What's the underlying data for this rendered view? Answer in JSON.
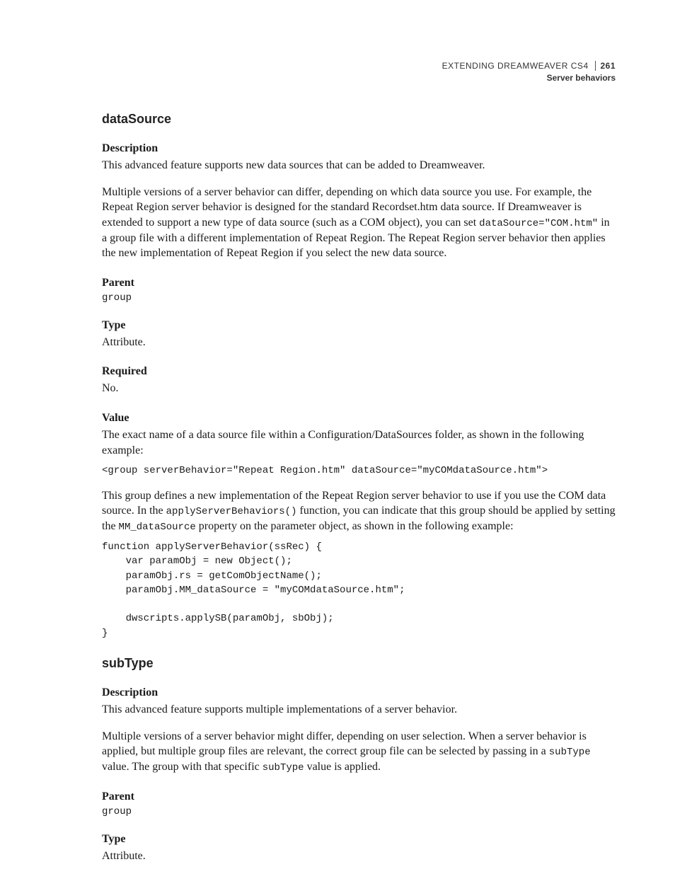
{
  "header": {
    "book": "EXTENDING DREAMWEAVER CS4",
    "page_number": "261",
    "chapter": "Server behaviors"
  },
  "section1": {
    "title": "dataSource",
    "description_label": "Description",
    "description_p1": "This advanced feature supports new data sources that can be added to Dreamweaver.",
    "description_p2_a": "Multiple versions of a server behavior can differ, depending on which data source you use. For example, the Repeat Region server behavior is designed for the standard Recordset.htm data source. If Dreamweaver is extended to support a new type of data source (such as a COM object), you can set ",
    "description_p2_code": "dataSource=\"COM.htm\"",
    "description_p2_b": " in a group file with a different implementation of Repeat Region. The Repeat Region server behavior then applies the new implementation of Repeat Region if you select the new data source.",
    "parent_label": "Parent",
    "parent_value": "group",
    "type_label": "Type",
    "type_value": "Attribute.",
    "required_label": "Required",
    "required_value": "No.",
    "value_label": "Value",
    "value_p1": "The exact name of a data source file within a Configuration/DataSources folder, as shown in the following example:",
    "value_code1": "<group serverBehavior=\"Repeat Region.htm\" dataSource=\"myCOMdataSource.htm\">",
    "value_p2_a": "This group defines a new implementation of the Repeat Region server behavior to use if you use the COM data source. In the ",
    "value_p2_code1": "applyServerBehaviors()",
    "value_p2_b": " function, you can indicate that this group should be applied by setting the ",
    "value_p2_code2": "MM_dataSource",
    "value_p2_c": " property on the parameter object, as shown in the following example:",
    "value_code2": "function applyServerBehavior(ssRec) {\n    var paramObj = new Object();\n    paramObj.rs = getComObjectName();\n    paramObj.MM_dataSource = \"myCOMdataSource.htm\";\n\n    dwscripts.applySB(paramObj, sbObj);\n}"
  },
  "section2": {
    "title": "subType",
    "description_label": "Description",
    "description_p1": "This advanced feature supports multiple implementations of a server behavior.",
    "description_p2_a": "Multiple versions of a server behavior might differ, depending on user selection. When a server behavior is applied, but multiple group files are relevant, the correct group file can be selected by passing in a ",
    "description_p2_code1": "subType",
    "description_p2_b": " value. The group with that specific ",
    "description_p2_code2": "subType",
    "description_p2_c": " value is applied.",
    "parent_label": "Parent",
    "parent_value": "group",
    "type_label": "Type",
    "type_value": "Attribute."
  }
}
